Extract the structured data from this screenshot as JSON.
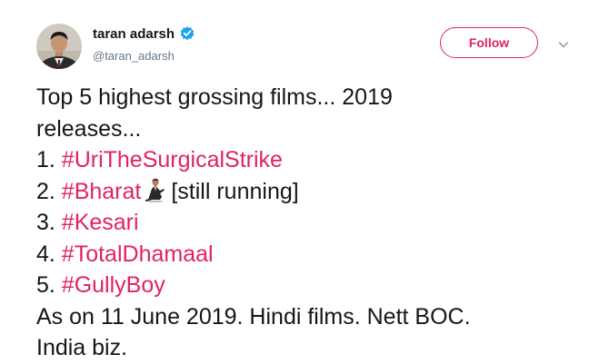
{
  "author": {
    "display_name": "taran adarsh",
    "handle": "@taran_adarsh",
    "verified": true
  },
  "follow_button": {
    "label": "Follow",
    "color": "#e0245e"
  },
  "menu": {
    "icon": "chevron-down-icon"
  },
  "tweet": {
    "intro_line1": "Top 5 highest grossing films... 2019",
    "intro_line2": "releases...",
    "items": [
      {
        "number": "1. ",
        "hashtag": "#UriTheSurgicalStrike",
        "suffix": ""
      },
      {
        "number": "2. ",
        "hashtag": "#Bharat",
        "emoji": "man-in-business-suit-levitating-icon",
        "suffix": "[still running]"
      },
      {
        "number": "3. ",
        "hashtag": "#Kesari",
        "suffix": ""
      },
      {
        "number": "4. ",
        "hashtag": "#TotalDhamaal",
        "suffix": ""
      },
      {
        "number": "5. ",
        "hashtag": "#GullyBoy",
        "suffix": ""
      }
    ],
    "footer_line1": "As on 11 June 2019. Hindi films. Nett BOC.",
    "footer_line2": "India biz."
  },
  "colors": {
    "hashtag": "#e0245e",
    "text": "#14171a",
    "secondary": "#657786",
    "verified_badge": "#1da1f2"
  }
}
